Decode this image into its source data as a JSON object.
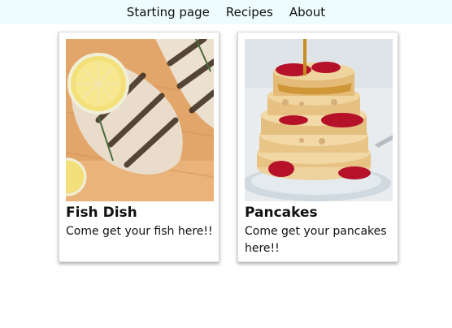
{
  "nav": {
    "items": [
      {
        "label": "Starting page"
      },
      {
        "label": "Recipes"
      },
      {
        "label": "About"
      }
    ]
  },
  "cards": [
    {
      "title": "Fish Dish",
      "description": "Come get your fish here!!",
      "image_icon": "grilled-fish-photo"
    },
    {
      "title": "Pancakes",
      "description": "Come get your pancakes here!!",
      "image_icon": "pancakes-photo"
    }
  ]
}
